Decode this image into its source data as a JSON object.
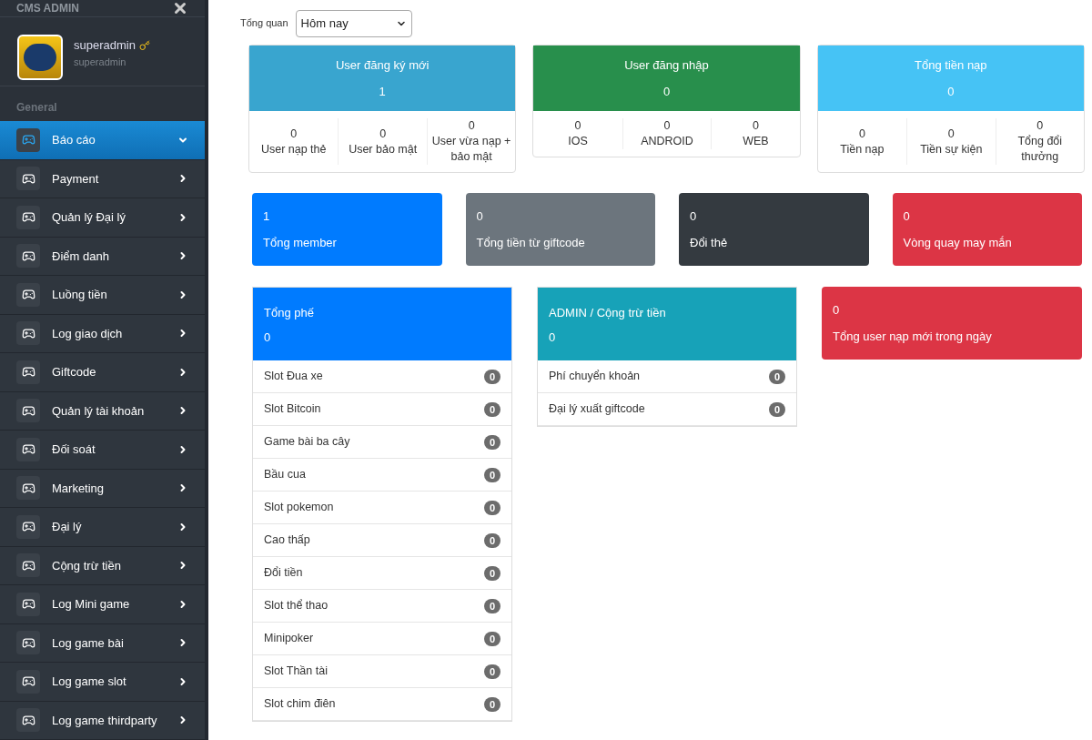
{
  "sidebar": {
    "title": "CMS ADMIN",
    "user": {
      "name": "superadmin",
      "role": "superadmin"
    },
    "section": "General",
    "items": [
      {
        "label": "Báo cáo",
        "selected": true
      },
      {
        "label": "Payment",
        "selected": false
      },
      {
        "label": "Quản lý Đại lý",
        "selected": false
      },
      {
        "label": "Điểm danh",
        "selected": false
      },
      {
        "label": "Luồng tiền",
        "selected": false
      },
      {
        "label": "Log giao dịch",
        "selected": false
      },
      {
        "label": "Giftcode",
        "selected": false
      },
      {
        "label": "Quản lý tài khoản",
        "selected": false
      },
      {
        "label": "Đối soát",
        "selected": false
      },
      {
        "label": "Marketing",
        "selected": false
      },
      {
        "label": "Đại lý",
        "selected": false
      },
      {
        "label": "Cộng trừ tiền",
        "selected": false
      },
      {
        "label": "Log Mini game",
        "selected": false
      },
      {
        "label": "Log game bài",
        "selected": false
      },
      {
        "label": "Log game slot",
        "selected": false
      },
      {
        "label": "Log game thirdparty",
        "selected": false
      }
    ]
  },
  "filter": {
    "label": "Tổng quan",
    "value": "Hôm nay"
  },
  "summary_cards": [
    {
      "title": "User đăng ký mới",
      "value": "1",
      "color": "#39a5cf",
      "stats": [
        {
          "value": "0",
          "label": "User nạp thẻ"
        },
        {
          "value": "0",
          "label": "User bảo mật"
        },
        {
          "value": "0",
          "label": "User vừa nạp + bảo mật"
        }
      ]
    },
    {
      "title": "User đăng nhập",
      "value": "0",
      "color": "#288f4c",
      "stats": [
        {
          "value": "0",
          "label": "IOS"
        },
        {
          "value": "0",
          "label": "ANDROID"
        },
        {
          "value": "0",
          "label": "WEB"
        }
      ]
    },
    {
      "title": "Tổng tiền nạp",
      "value": "0",
      "color": "#46c3f5",
      "stats": [
        {
          "value": "0",
          "label": "Tiền nạp"
        },
        {
          "value": "0",
          "label": "Tiền sự kiện"
        },
        {
          "value": "0",
          "label": "Tổng đổi thưởng"
        }
      ]
    }
  ],
  "tiles": [
    {
      "value": "1",
      "label": "Tổng member",
      "color": "#007bff"
    },
    {
      "value": "0",
      "label": "Tổng tiền từ giftcode",
      "color": "#6c757d"
    },
    {
      "value": "0",
      "label": "Đổi thẻ",
      "color": "#343a40"
    },
    {
      "value": "0",
      "label": "Vòng quay may mắn",
      "color": "#dc3545"
    }
  ],
  "panels": [
    {
      "kind": "list",
      "title": "Tổng phế",
      "value": "0",
      "color": "#007bff",
      "items": [
        {
          "label": "Slot Đua xe",
          "count": "0"
        },
        {
          "label": "Slot Bitcoin",
          "count": "0"
        },
        {
          "label": "Game bài ba cây",
          "count": "0"
        },
        {
          "label": "Bầu cua",
          "count": "0"
        },
        {
          "label": "Slot pokemon",
          "count": "0"
        },
        {
          "label": "Cao thấp",
          "count": "0"
        },
        {
          "label": "Đổi tiền",
          "count": "0"
        },
        {
          "label": "Slot thể thao",
          "count": "0"
        },
        {
          "label": "Minipoker",
          "count": "0"
        },
        {
          "label": "Slot Thần tài",
          "count": "0"
        },
        {
          "label": "Slot chim điên",
          "count": "0"
        }
      ]
    },
    {
      "kind": "list",
      "title": "ADMIN / Cộng trừ tiền",
      "value": "0",
      "color": "#17a2b8",
      "items": [
        {
          "label": "Phí chuyển khoản",
          "count": "0"
        },
        {
          "label": "Đại lý xuất giftcode",
          "count": "0"
        }
      ]
    },
    {
      "kind": "tile",
      "title": "Tổng user nạp mới trong ngày",
      "value": "0",
      "color": "#dc3545"
    }
  ]
}
